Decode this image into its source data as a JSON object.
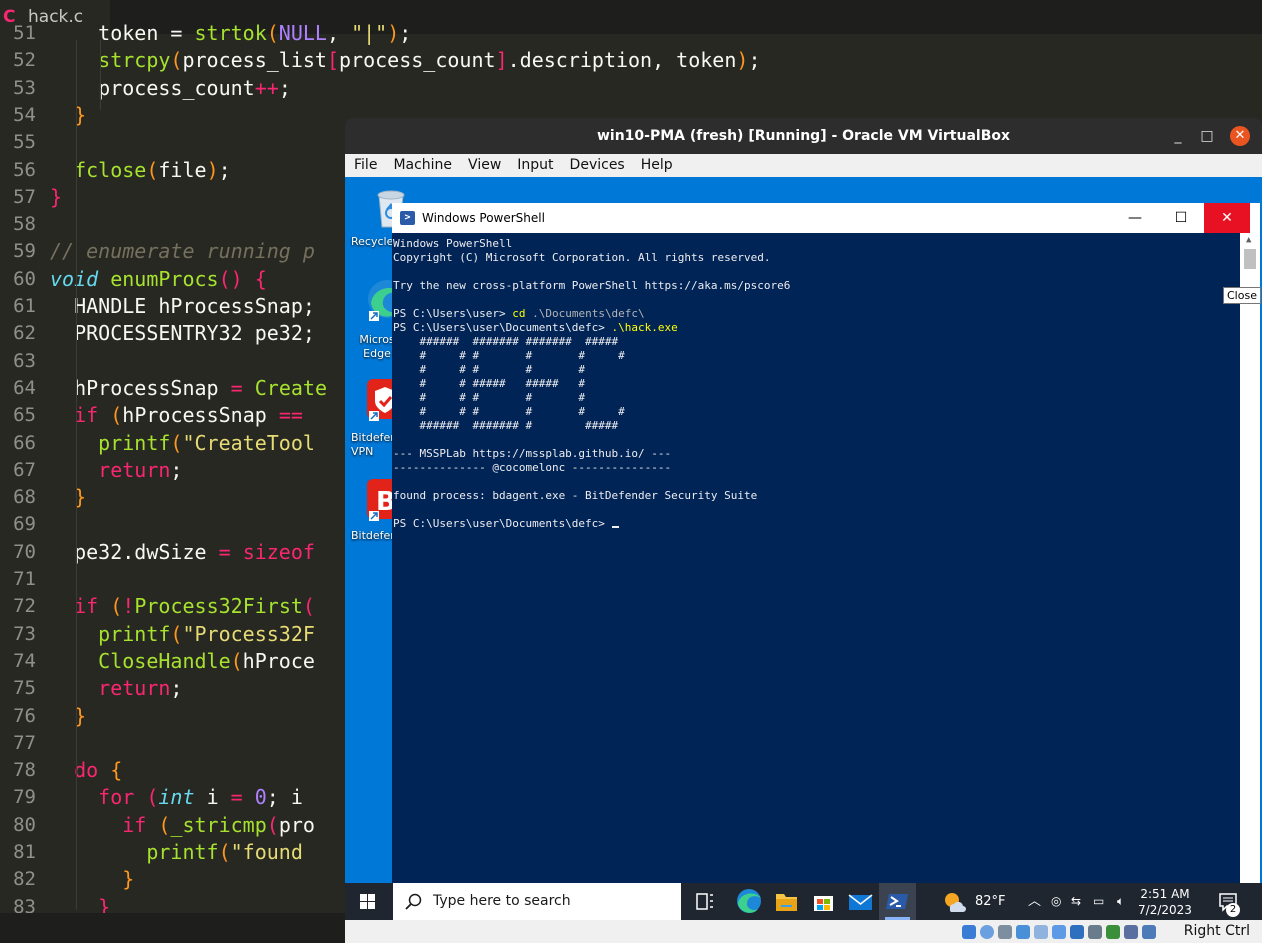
{
  "editor": {
    "tab_title": "hack.c",
    "tab_icon": "c-language-icon",
    "lines": [
      {
        "n": "51",
        "html": "    <span class='pu'>token = </span><span class='fn'>strtok</span><span class='p1'>(</span><span class='nu'>NULL</span><span class='pu'>, </span><span class='st'>\"|\"</span><span class='p1'>)</span><span class='pu'>;</span>"
      },
      {
        "n": "52",
        "html": "    <span class='fn'>strcpy</span><span class='p1'>(</span><span class='pu'>process_list</span><span class='p2'>[</span><span class='pu'>process_count</span><span class='p2'>]</span><span class='pu'>.description, token</span><span class='p1'>)</span><span class='pu'>;</span>"
      },
      {
        "n": "53",
        "html": "    <span class='pu'>process_count</span><span class='kw'>++</span><span class='pu'>;</span>"
      },
      {
        "n": "54",
        "html": "  <span class='p1'>}</span>"
      },
      {
        "n": "55",
        "html": ""
      },
      {
        "n": "56",
        "html": "  <span class='fn'>fclose</span><span class='p1'>(</span><span class='pu'>file</span><span class='p1'>)</span><span class='pu'>;</span>"
      },
      {
        "n": "57",
        "html": "<span class='p2'>}</span>"
      },
      {
        "n": "58",
        "html": ""
      },
      {
        "n": "59",
        "html": "<span class='cm'>// enumerate running p</span>"
      },
      {
        "n": "60",
        "html": "<span class='ty'>void</span> <span class='fn'>enumProcs</span><span class='p2'>()</span> <span class='p2'>{</span>"
      },
      {
        "n": "61",
        "html": "  <span class='pu'>HANDLE hProcessSnap;</span>"
      },
      {
        "n": "62",
        "html": "  <span class='pu'>PROCESSENTRY32 pe32;</span>"
      },
      {
        "n": "63",
        "html": ""
      },
      {
        "n": "64",
        "html": "  <span class='pu'>hProcessSnap </span><span class='kw'>=</span> <span class='fn'>Create</span>"
      },
      {
        "n": "65",
        "html": "  <span class='kw'>if</span> <span class='p1'>(</span><span class='pu'>hProcessSnap </span><span class='kw'>==</span>"
      },
      {
        "n": "66",
        "html": "    <span class='fn'>printf</span><span class='p1'>(</span><span class='st'>\"CreateTool</span>"
      },
      {
        "n": "67",
        "html": "    <span class='kw'>return</span><span class='pu'>;</span>"
      },
      {
        "n": "68",
        "html": "  <span class='p1'>}</span>"
      },
      {
        "n": "69",
        "html": ""
      },
      {
        "n": "70",
        "html": "  <span class='pu'>pe32.dwSize </span><span class='kw'>=</span> <span class='kw'>sizeof</span>"
      },
      {
        "n": "71",
        "html": ""
      },
      {
        "n": "72",
        "html": "  <span class='kw'>if</span> <span class='p1'>(</span><span class='kw'>!</span><span class='fn'>Process32First</span><span class='p2'>(</span>"
      },
      {
        "n": "73",
        "html": "    <span class='fn'>printf</span><span class='p1'>(</span><span class='st'>\"Process32F</span>"
      },
      {
        "n": "74",
        "html": "    <span class='fn'>CloseHandle</span><span class='p1'>(</span><span class='pu'>hProce</span>"
      },
      {
        "n": "75",
        "html": "    <span class='kw'>return</span><span class='pu'>;</span>"
      },
      {
        "n": "76",
        "html": "  <span class='p1'>}</span>"
      },
      {
        "n": "77",
        "html": ""
      },
      {
        "n": "78",
        "html": "  <span class='kw'>do</span> <span class='p1'>{</span>"
      },
      {
        "n": "79",
        "html": "    <span class='kw'>for</span> <span class='p2'>(</span><span class='ty'>int</span> <span class='pu'>i </span><span class='kw'>=</span> <span class='nu'>0</span><span class='pu'>; i</span>"
      },
      {
        "n": "80",
        "html": "      <span class='kw'>if</span> <span class='p1'>(</span><span class='fn'>_stricmp</span><span class='p2'>(</span><span class='pu'>pro</span>"
      },
      {
        "n": "81",
        "html": "        <span class='fn'>printf</span><span class='p1'>(</span><span class='st'>\"found </span>"
      },
      {
        "n": "82",
        "html": "      <span class='p1'>}</span>"
      },
      {
        "n": "83",
        "html": "    <span class='p2'>}</span>"
      }
    ]
  },
  "vbox": {
    "title": "win10-PMA (fresh) [Running] - Oracle VM VirtualBox",
    "controls": {
      "minimize": "_",
      "maximize": "□",
      "close": "✕"
    },
    "menu": [
      "File",
      "Machine",
      "View",
      "Input",
      "Devices",
      "Help"
    ],
    "host_key": "Right Ctrl"
  },
  "desktop": {
    "icons": [
      {
        "name": "recycle-bin-icon",
        "label": "Recycle"
      },
      {
        "name": "edge-desktop-icon",
        "label": "Micros Edge"
      },
      {
        "name": "bitdefender-vpn-icon",
        "label": "Bitdefen VPN"
      },
      {
        "name": "bitdefender-icon",
        "label": "Bitdefen"
      }
    ]
  },
  "powershell": {
    "title": "Windows PowerShell",
    "tooltip": "Close",
    "controls": {
      "minimize": "—",
      "maximize": "☐",
      "close": "✕"
    },
    "lines": [
      {
        "t": "Windows PowerShell",
        "c": ""
      },
      {
        "t": "Copyright (C) Microsoft Corporation. All rights reserved.",
        "c": ""
      },
      {
        "t": "",
        "c": ""
      },
      {
        "t": "Try the new cross-platform PowerShell https://aka.ms/pscore6",
        "c": ""
      },
      {
        "t": "",
        "c": ""
      },
      {
        "t": "PS C:\\Users\\user> ",
        "y": "cd",
        "g": " .\\Documents\\defc\\"
      },
      {
        "t": "PS C:\\Users\\user\\Documents\\defc> ",
        "y": ".\\hack.exe"
      },
      {
        "t": "    ######  ####### #######  #####",
        "c": ""
      },
      {
        "t": "    #     # #       #       #     #",
        "c": ""
      },
      {
        "t": "    #     # #       #       #",
        "c": ""
      },
      {
        "t": "    #     # #####   #####   #",
        "c": ""
      },
      {
        "t": "    #     # #       #       #",
        "c": ""
      },
      {
        "t": "    #     # #       #       #     #",
        "c": ""
      },
      {
        "t": "    ######  ####### #        #####",
        "c": ""
      },
      {
        "t": "",
        "c": ""
      },
      {
        "t": "--- MSSPLab https://mssplab.github.io/ ---",
        "c": ""
      },
      {
        "t": "-------------- @cocomelonc ---------------",
        "c": ""
      },
      {
        "t": "",
        "c": ""
      },
      {
        "t": "found process: bdagent.exe - BitDefender Security Suite",
        "c": ""
      },
      {
        "t": "",
        "c": ""
      },
      {
        "t": "PS C:\\Users\\user\\Documents\\defc> ",
        "cursor": true
      }
    ]
  },
  "taskbar": {
    "search_placeholder": "Type here to search",
    "weather": "82°F",
    "time": "2:51 AM",
    "date": "7/2/2023",
    "notification_count": "2"
  }
}
